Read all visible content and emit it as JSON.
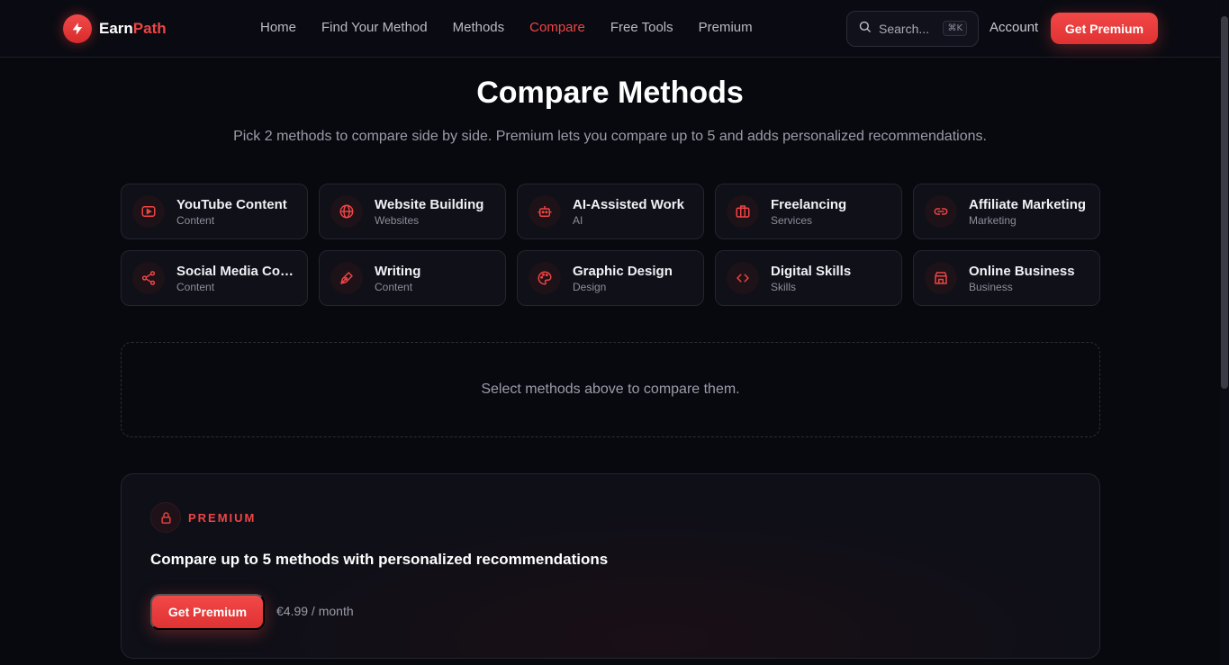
{
  "brand": {
    "name_part1": "Earn",
    "name_part2": "Path",
    "icon": "bolt-icon",
    "accent_color": "#ef4444"
  },
  "nav": {
    "items": [
      {
        "label": "Home",
        "active": false
      },
      {
        "label": "Find Your Method",
        "active": false
      },
      {
        "label": "Methods",
        "active": false
      },
      {
        "label": "Compare",
        "active": true
      },
      {
        "label": "Free Tools",
        "active": false
      },
      {
        "label": "Premium",
        "active": false
      }
    ]
  },
  "search": {
    "placeholder": "Search...",
    "shortcut": "⌘K",
    "icon": "search-icon"
  },
  "header": {
    "account_label": "Account",
    "premium_button": "Get Premium"
  },
  "page": {
    "title": "Compare Methods",
    "subtitle": "Pick 2 methods to compare side by side. Premium lets you compare up to 5 and adds personalized recommendations."
  },
  "methods": [
    {
      "title": "YouTube Content",
      "category": "Content",
      "icon": "youtube-icon"
    },
    {
      "title": "Website Building",
      "category": "Websites",
      "icon": "globe-icon"
    },
    {
      "title": "AI-Assisted Work",
      "category": "AI",
      "icon": "robot-icon"
    },
    {
      "title": "Freelancing",
      "category": "Services",
      "icon": "briefcase-icon"
    },
    {
      "title": "Affiliate Marketing",
      "category": "Marketing",
      "icon": "link-icon"
    },
    {
      "title": "Social Media Content",
      "category": "Content",
      "icon": "share-icon"
    },
    {
      "title": "Writing",
      "category": "Content",
      "icon": "pen-icon"
    },
    {
      "title": "Graphic Design",
      "category": "Design",
      "icon": "palette-icon"
    },
    {
      "title": "Digital Skills",
      "category": "Skills",
      "icon": "code-icon"
    },
    {
      "title": "Online Business",
      "category": "Business",
      "icon": "store-icon"
    }
  ],
  "empty_state": {
    "text": "Select methods above to compare them."
  },
  "promo": {
    "label": "PREMIUM",
    "heading": "Compare up to 5 methods with personalized recommendations",
    "button": "Get Premium",
    "price": "€4.99 / month",
    "icon": "lock-icon"
  }
}
